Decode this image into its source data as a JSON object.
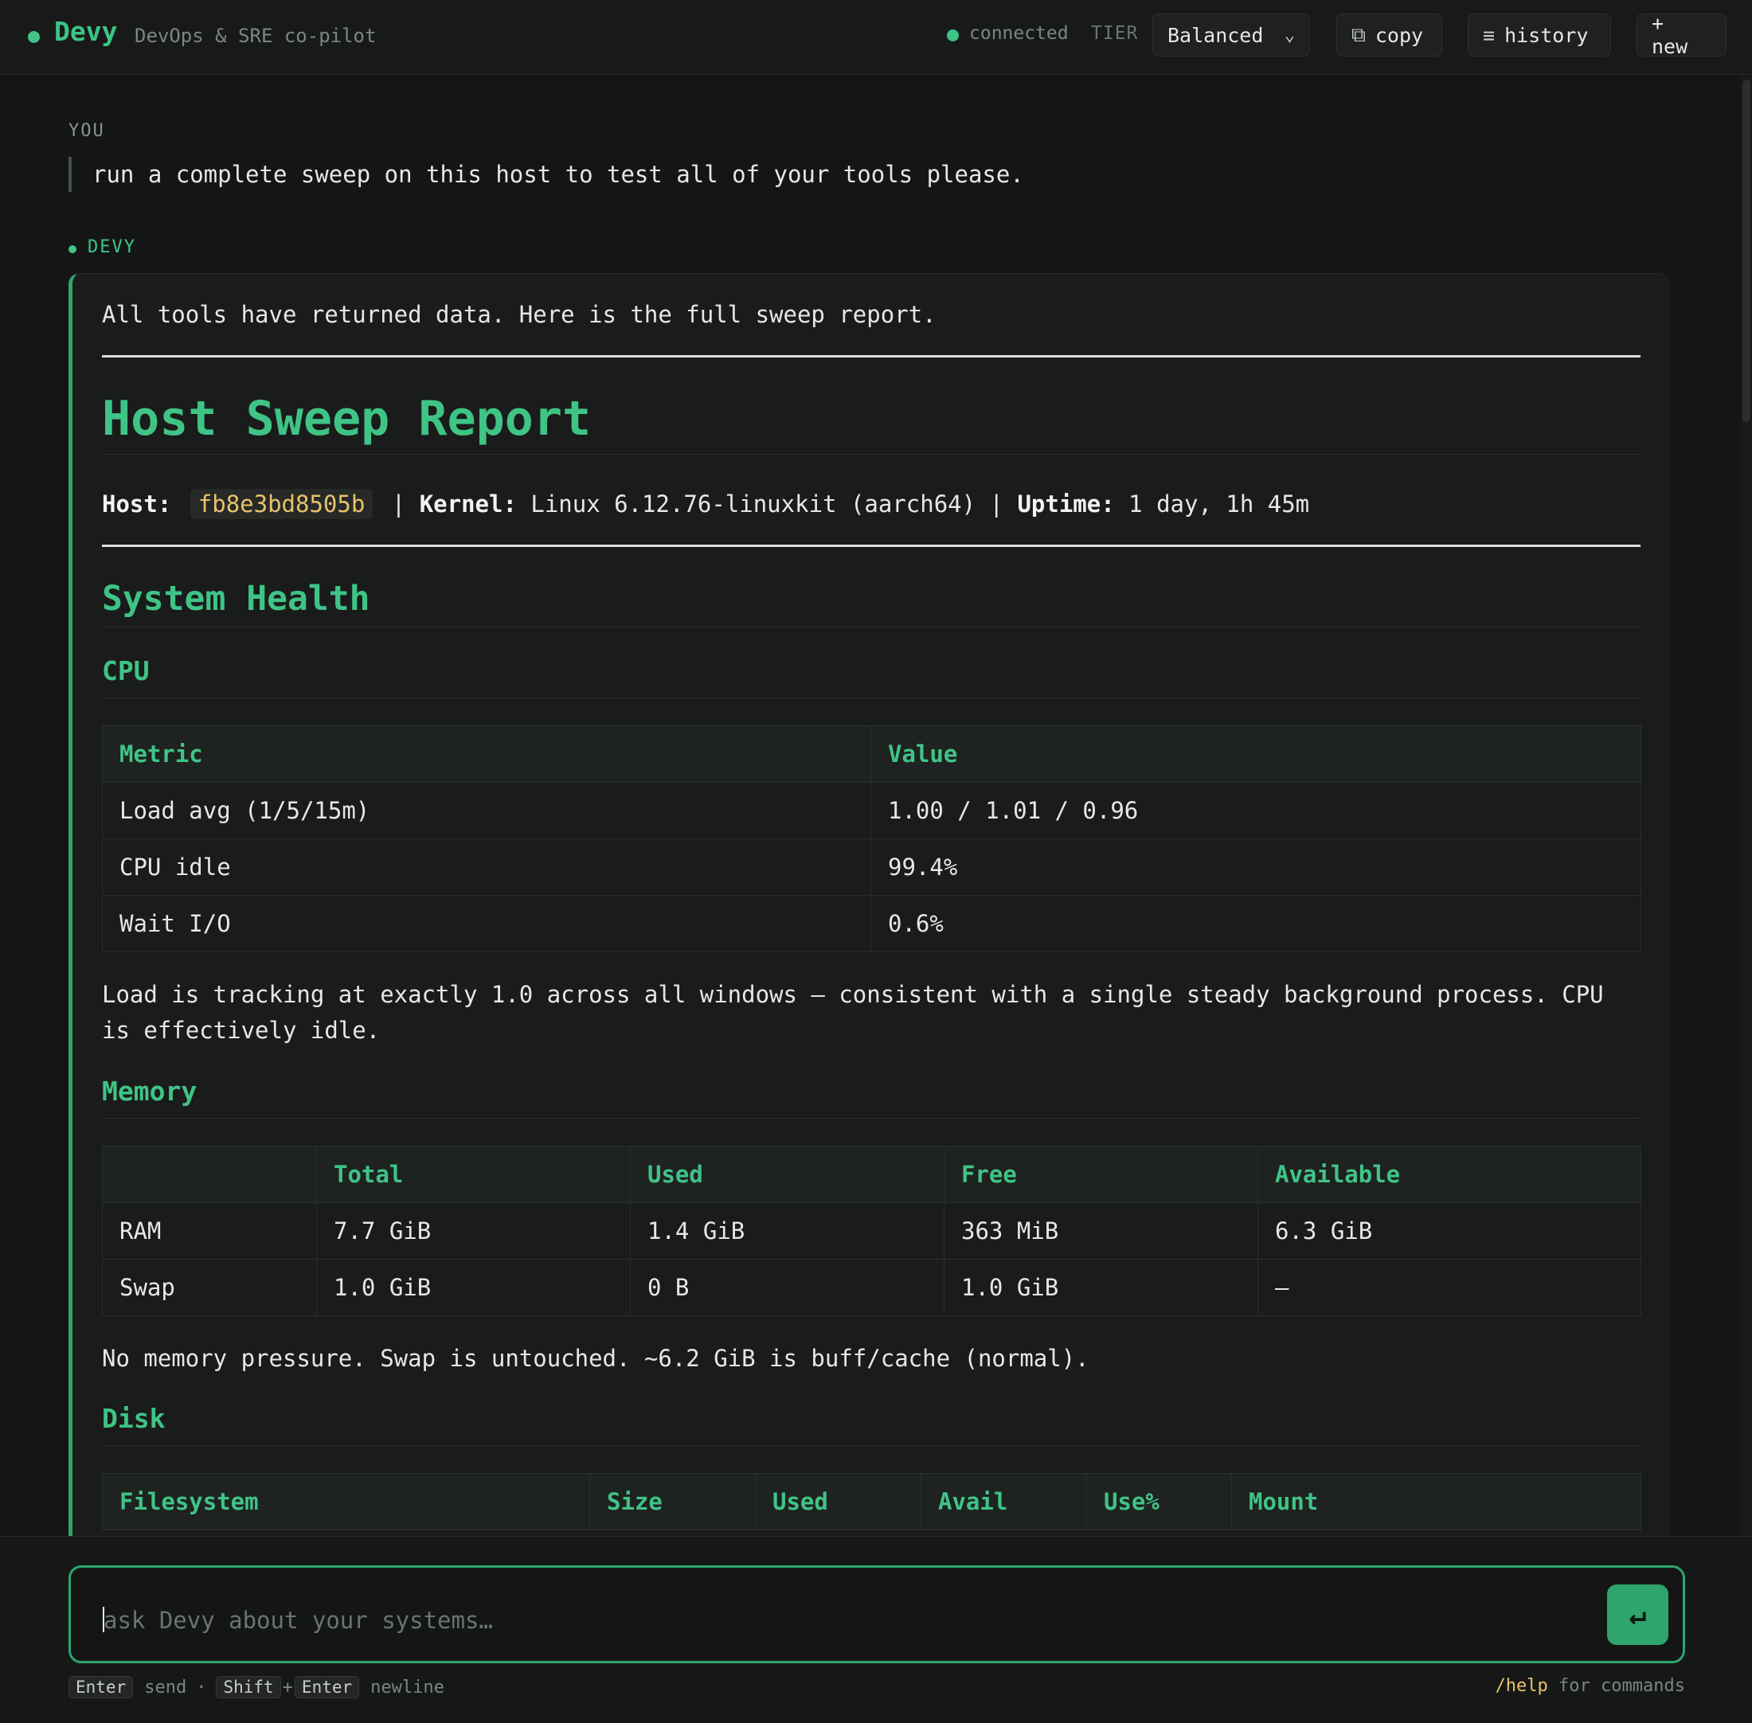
{
  "app": {
    "name": "Devy",
    "subtitle": "DevOps & SRE co-pilot",
    "status": "connected",
    "tier_label": "TIER",
    "tier_value": "Balanced",
    "copy_label": "copy",
    "history_label": "history",
    "new_label": "+ new",
    "accent_color": "#3fc486"
  },
  "conversation": {
    "user_label": "YOU",
    "user_message": "run a complete sweep on this host to test all of your tools please.",
    "assistant_label": "DEVY",
    "intro": "All tools have returned data. Here is the full sweep report.",
    "report": {
      "title": "Host Sweep Report",
      "host_label": "Host:",
      "host_value": "fb8e3bd8505b",
      "kernel_label": "Kernel:",
      "kernel_value": "Linux 6.12.76-linuxkit (aarch64)",
      "uptime_label": "Uptime:",
      "uptime_value": "1 day, 1h 45m",
      "system_health_heading": "System Health",
      "cpu": {
        "heading": "CPU",
        "columns": [
          "Metric",
          "Value"
        ],
        "rows": [
          [
            "Load avg (1/5/15m)",
            "1.00 / 1.01 / 0.96"
          ],
          [
            "CPU idle",
            "99.4%"
          ],
          [
            "Wait I/O",
            "0.6%"
          ]
        ],
        "note": "Load is tracking at exactly 1.0 across all windows — consistent with a single steady background process. CPU is effectively idle."
      },
      "memory": {
        "heading": "Memory",
        "columns": [
          "",
          "Total",
          "Used",
          "Free",
          "Available"
        ],
        "rows": [
          [
            "RAM",
            "7.7 GiB",
            "1.4 GiB",
            "363 MiB",
            "6.3 GiB"
          ],
          [
            "Swap",
            "1.0 GiB",
            "0 B",
            "1.0 GiB",
            "—"
          ]
        ],
        "note": "No memory pressure. Swap is untouched. ~6.2 GiB is buff/cache (normal)."
      },
      "disk": {
        "heading": "Disk",
        "columns": [
          "Filesystem",
          "Size",
          "Used",
          "Avail",
          "Use%",
          "Mount"
        ]
      }
    }
  },
  "composer": {
    "placeholder": "ask Devy about your systems…",
    "send_glyph": "↵",
    "hint_enter": "Enter",
    "hint_send": "send",
    "hint_dot": "·",
    "hint_shift": "Shift",
    "hint_plus": "+",
    "hint_enter2": "Enter",
    "hint_newline": "newline",
    "help_cmd": "/help",
    "help_text": "for commands"
  }
}
